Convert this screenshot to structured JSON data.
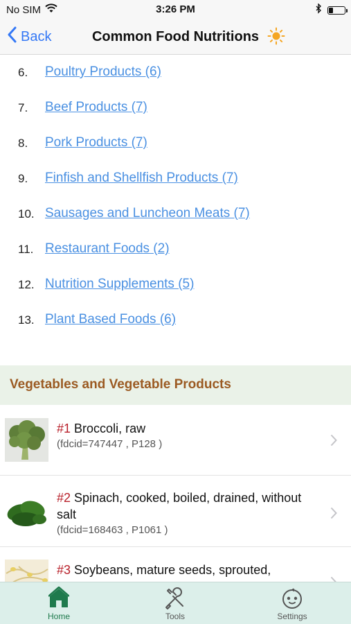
{
  "status_bar": {
    "carrier": "No SIM",
    "time": "3:26 PM",
    "battery_level": 0.3
  },
  "nav": {
    "back_label": "Back",
    "title": "Common Food Nutritions",
    "title_icon": "sun-icon"
  },
  "categories": [
    {
      "num": "6.",
      "label": "Poultry Products (6)"
    },
    {
      "num": "7.",
      "label": "Beef Products (7)"
    },
    {
      "num": "8.",
      "label": "Pork Products (7)"
    },
    {
      "num": "9.",
      "label": "Finfish and Shellfish Products (7)"
    },
    {
      "num": "10.",
      "label": "Sausages and Luncheon Meats (7)"
    },
    {
      "num": "11.",
      "label": "Restaurant Foods (2)"
    },
    {
      "num": "12.",
      "label": "Nutrition Supplements (5)"
    },
    {
      "num": "13.",
      "label": "Plant Based Foods (6)"
    }
  ],
  "section": {
    "title": "Vegetables and Vegetable Products"
  },
  "foods": [
    {
      "rank": "#1",
      "name": "Broccoli, raw",
      "meta": "(fdcid=747447 , P128 )"
    },
    {
      "rank": "#2",
      "name": "Spinach, cooked, boiled, drained, without salt",
      "meta": "(fdcid=168463 , P1061 )"
    },
    {
      "rank": "#3",
      "name": "Soybeans, mature seeds, sprouted,",
      "meta": ""
    }
  ],
  "tabs": [
    {
      "label": "Home",
      "icon": "home-icon",
      "active": true
    },
    {
      "label": "Tools",
      "icon": "tools-icon",
      "active": false
    },
    {
      "label": "Settings",
      "icon": "baby-face-icon",
      "active": false
    }
  ],
  "colors": {
    "link": "#4a90e2",
    "ios_blue": "#3478f6",
    "section_bg": "#eaf2e8",
    "section_text": "#9b5a22",
    "rank_red": "#b8202a",
    "tab_bar_bg": "#dcefea",
    "tab_active": "#1f7a4d"
  }
}
